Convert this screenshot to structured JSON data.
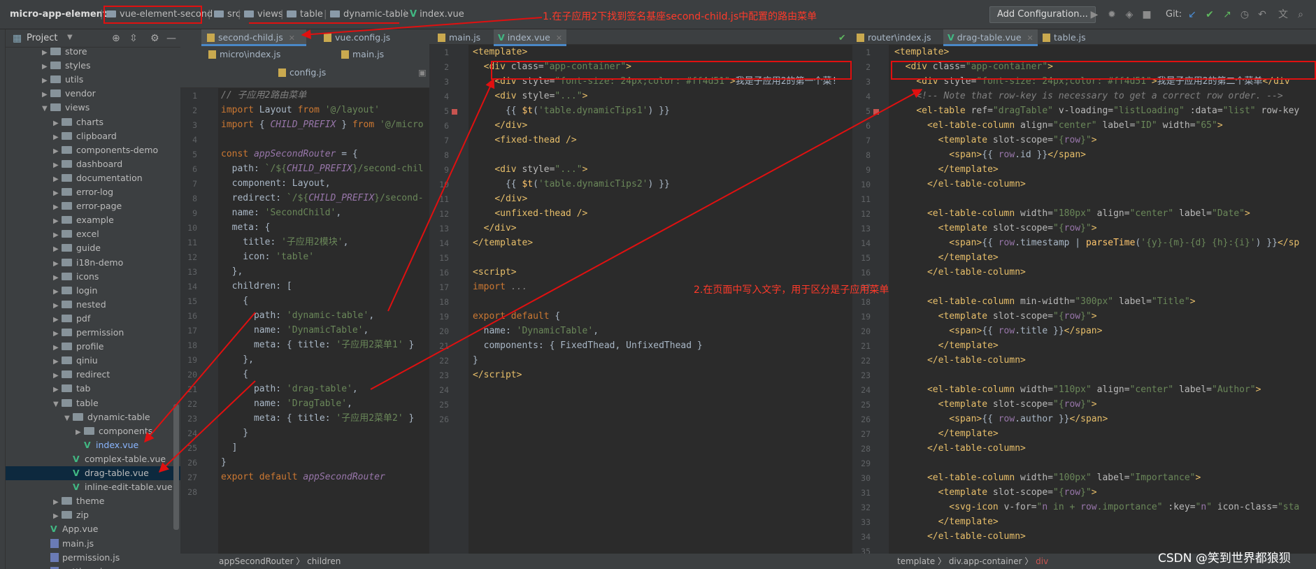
{
  "breadcrumb": {
    "project": "micro-app-element",
    "items": [
      "vue-element-second",
      "src",
      "views",
      "table",
      "dynamic-table",
      "index.vue"
    ]
  },
  "annotation1": "1.在子应用2下找到签名基座second-child.js中配置的路由菜单",
  "annotation2": "2.在页面中写入文字，用于区分是子应用菜单",
  "toolbar": {
    "add_config": "Add Configuration...",
    "git_label": "Git:"
  },
  "project_panel": {
    "title": "Project",
    "side_label": "1: Project"
  },
  "tree": [
    {
      "label": "store",
      "type": "folder",
      "depth": 2,
      "tri": "▶"
    },
    {
      "label": "styles",
      "type": "folder",
      "depth": 2,
      "tri": "▶"
    },
    {
      "label": "utils",
      "type": "folder",
      "depth": 2,
      "tri": "▶"
    },
    {
      "label": "vendor",
      "type": "folder",
      "depth": 2,
      "tri": "▶"
    },
    {
      "label": "views",
      "type": "folder",
      "depth": 2,
      "tri": "▼"
    },
    {
      "label": "charts",
      "type": "folder",
      "depth": 3,
      "tri": "▶"
    },
    {
      "label": "clipboard",
      "type": "folder",
      "depth": 3,
      "tri": "▶"
    },
    {
      "label": "components-demo",
      "type": "folder",
      "depth": 3,
      "tri": "▶"
    },
    {
      "label": "dashboard",
      "type": "folder",
      "depth": 3,
      "tri": "▶"
    },
    {
      "label": "documentation",
      "type": "folder",
      "depth": 3,
      "tri": "▶"
    },
    {
      "label": "error-log",
      "type": "folder",
      "depth": 3,
      "tri": "▶"
    },
    {
      "label": "error-page",
      "type": "folder",
      "depth": 3,
      "tri": "▶"
    },
    {
      "label": "example",
      "type": "folder",
      "depth": 3,
      "tri": "▶"
    },
    {
      "label": "excel",
      "type": "folder",
      "depth": 3,
      "tri": "▶"
    },
    {
      "label": "guide",
      "type": "folder",
      "depth": 3,
      "tri": "▶"
    },
    {
      "label": "i18n-demo",
      "type": "folder",
      "depth": 3,
      "tri": "▶"
    },
    {
      "label": "icons",
      "type": "folder",
      "depth": 3,
      "tri": "▶"
    },
    {
      "label": "login",
      "type": "folder",
      "depth": 3,
      "tri": "▶"
    },
    {
      "label": "nested",
      "type": "folder",
      "depth": 3,
      "tri": "▶"
    },
    {
      "label": "pdf",
      "type": "folder",
      "depth": 3,
      "tri": "▶"
    },
    {
      "label": "permission",
      "type": "folder",
      "depth": 3,
      "tri": "▶"
    },
    {
      "label": "profile",
      "type": "folder",
      "depth": 3,
      "tri": "▶"
    },
    {
      "label": "qiniu",
      "type": "folder",
      "depth": 3,
      "tri": "▶"
    },
    {
      "label": "redirect",
      "type": "folder",
      "depth": 3,
      "tri": "▶"
    },
    {
      "label": "tab",
      "type": "folder",
      "depth": 3,
      "tri": "▶"
    },
    {
      "label": "table",
      "type": "folder",
      "depth": 3,
      "tri": "▼"
    },
    {
      "label": "dynamic-table",
      "type": "folder",
      "depth": 4,
      "tri": "▼"
    },
    {
      "label": "components",
      "type": "folder",
      "depth": 5,
      "tri": "▶"
    },
    {
      "label": "index.vue",
      "type": "vue",
      "depth": 5,
      "tri": "",
      "blue": true
    },
    {
      "label": "complex-table.vue",
      "type": "vue",
      "depth": 4,
      "tri": ""
    },
    {
      "label": "drag-table.vue",
      "type": "vue",
      "depth": 4,
      "tri": "",
      "selected": true
    },
    {
      "label": "inline-edit-table.vue",
      "type": "vue",
      "depth": 4,
      "tri": ""
    },
    {
      "label": "theme",
      "type": "folder",
      "depth": 3,
      "tri": "▶"
    },
    {
      "label": "zip",
      "type": "folder",
      "depth": 3,
      "tri": "▶"
    },
    {
      "label": "App.vue",
      "type": "vue",
      "depth": 2,
      "tri": ""
    },
    {
      "label": "main.js",
      "type": "js",
      "depth": 2,
      "tri": ""
    },
    {
      "label": "permission.js",
      "type": "js",
      "depth": 2,
      "tri": ""
    },
    {
      "label": "settings.js",
      "type": "js",
      "depth": 2,
      "tri": ""
    }
  ],
  "pane1": {
    "tabs_row1": [
      {
        "label": "second-child.js",
        "type": "js",
        "active": true
      },
      {
        "label": "vue.config.js",
        "type": "js"
      }
    ],
    "tabs_row2": [
      {
        "label": "micro\\index.js",
        "type": "js"
      },
      {
        "label": "main.js",
        "type": "js"
      }
    ],
    "tabs_row3": [
      {
        "label": "config.js",
        "type": "js"
      }
    ],
    "status": [
      "appSecondRouter",
      "children"
    ]
  },
  "pane2": {
    "tabs": [
      {
        "label": "main.js",
        "type": "js"
      },
      {
        "label": "index.vue",
        "type": "vue",
        "active": true
      }
    ]
  },
  "pane3": {
    "tabs": [
      {
        "label": "router\\index.js",
        "type": "js"
      },
      {
        "label": "drag-table.vue",
        "type": "vue",
        "active": true
      },
      {
        "label": "table.js",
        "type": "js"
      }
    ],
    "status": [
      "template",
      "div.app-container",
      "div"
    ]
  },
  "watermark": "CSDN @笑到世界都狼狈"
}
